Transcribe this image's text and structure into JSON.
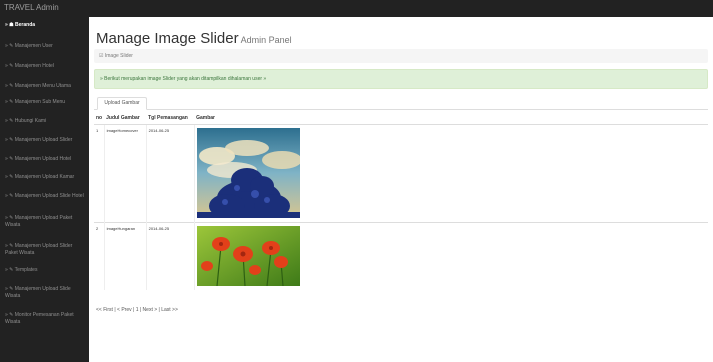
{
  "app": {
    "brand": "TRAVEL Admin"
  },
  "sidebar": {
    "items": [
      {
        "label": "» ☗ Beranda"
      },
      {
        "label": "» ✎ Manajemen User"
      },
      {
        "label": "» ✎ Manajemen Hotel"
      },
      {
        "label": "» ✎ Manajemen Menu Utama"
      },
      {
        "label": "» ✎ Manajemen Sub Menu"
      },
      {
        "label": "» ✎ Hubungi Kami"
      },
      {
        "label": "» ✎ Manajemen Upload Slider"
      },
      {
        "label": "» ✎ Manajemen Upload Hotel"
      },
      {
        "label": "» ✎ Manajemen Upload Kamar"
      },
      {
        "label": "» ✎ Manajemen Upload Slide Hotel"
      },
      {
        "label": "» ✎ Manajemen Upload Paket Wisata"
      },
      {
        "label": "» ✎ Manajemen Upload Slider Paket Wisata"
      },
      {
        "label": "» ✎ Templates"
      },
      {
        "label": "» ✎ Manajemen Upload Slide Wisata"
      },
      {
        "label": "» ✎ Monitor Pemesanan Paket Wisata"
      }
    ]
  },
  "header": {
    "title": "Manage Image Slider",
    "subtitle": "Admin Panel"
  },
  "breadcrumb": {
    "label": "☑ Image Slider"
  },
  "alert": {
    "text": "» Berikut merupakan image Slider yang akan ditampilkan dihalaman user »"
  },
  "tabs": [
    {
      "label": "Upload Gambar"
    }
  ],
  "table": {
    "headers": [
      "no",
      "Judul Gambar",
      "Tgl Pemasangan",
      "Gambar"
    ],
    "rows": [
      {
        "no": "1",
        "judul": "imageHomecover",
        "tgl": "2014-06-25"
      },
      {
        "no": "2",
        "judul": "imageHungaran",
        "tgl": "2014-06-25"
      }
    ]
  },
  "pager": {
    "text": "<< First | < Prev | 1 | Next > | Last >>"
  },
  "colors": {
    "sidebar": "#222222",
    "navbar": "#222222",
    "alert_bg": "#dff0d8",
    "alert_text": "#3c763d"
  }
}
